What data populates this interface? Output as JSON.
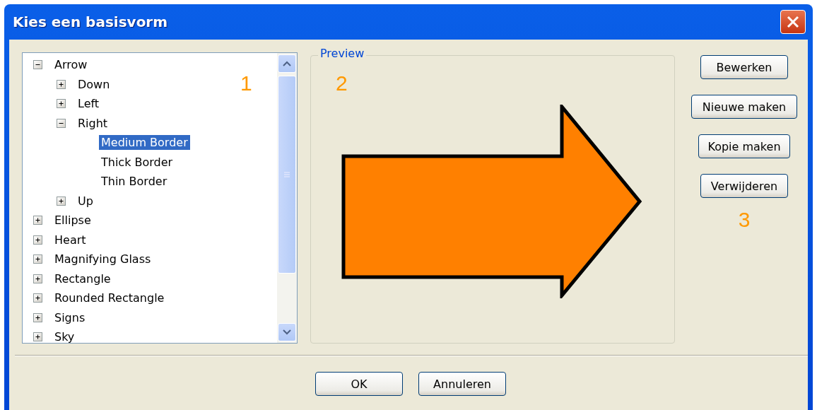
{
  "window": {
    "title": "Kies een basisvorm"
  },
  "tree": {
    "annotation": "1",
    "items": [
      {
        "label": "Arrow",
        "expanded": true,
        "selected": false,
        "children": [
          {
            "label": "Down",
            "expanded": false,
            "selected": false
          },
          {
            "label": "Left",
            "expanded": false,
            "selected": false
          },
          {
            "label": "Right",
            "expanded": true,
            "selected": false,
            "children": [
              {
                "label": "Medium Border",
                "selected": true
              },
              {
                "label": "Thick Border",
                "selected": false
              },
              {
                "label": "Thin Border",
                "selected": false
              }
            ]
          },
          {
            "label": "Up",
            "expanded": false,
            "selected": false
          }
        ]
      },
      {
        "label": "Ellipse",
        "expanded": false,
        "selected": false
      },
      {
        "label": "Heart",
        "expanded": false,
        "selected": false
      },
      {
        "label": "Magnifying Glass",
        "expanded": false,
        "selected": false
      },
      {
        "label": "Rectangle",
        "expanded": false,
        "selected": false
      },
      {
        "label": "Rounded Rectangle",
        "expanded": false,
        "selected": false
      },
      {
        "label": "Signs",
        "expanded": false,
        "selected": false
      },
      {
        "label": "Sky",
        "expanded": false,
        "selected": false
      }
    ]
  },
  "preview": {
    "legend": "Preview",
    "annotation": "2"
  },
  "actions": {
    "buttons": [
      "Bewerken",
      "Nieuwe maken",
      "Kopie maken",
      "Verwijderen"
    ],
    "annotation": "3"
  },
  "footer": {
    "buttons": [
      "OK",
      "Annuleren"
    ]
  }
}
